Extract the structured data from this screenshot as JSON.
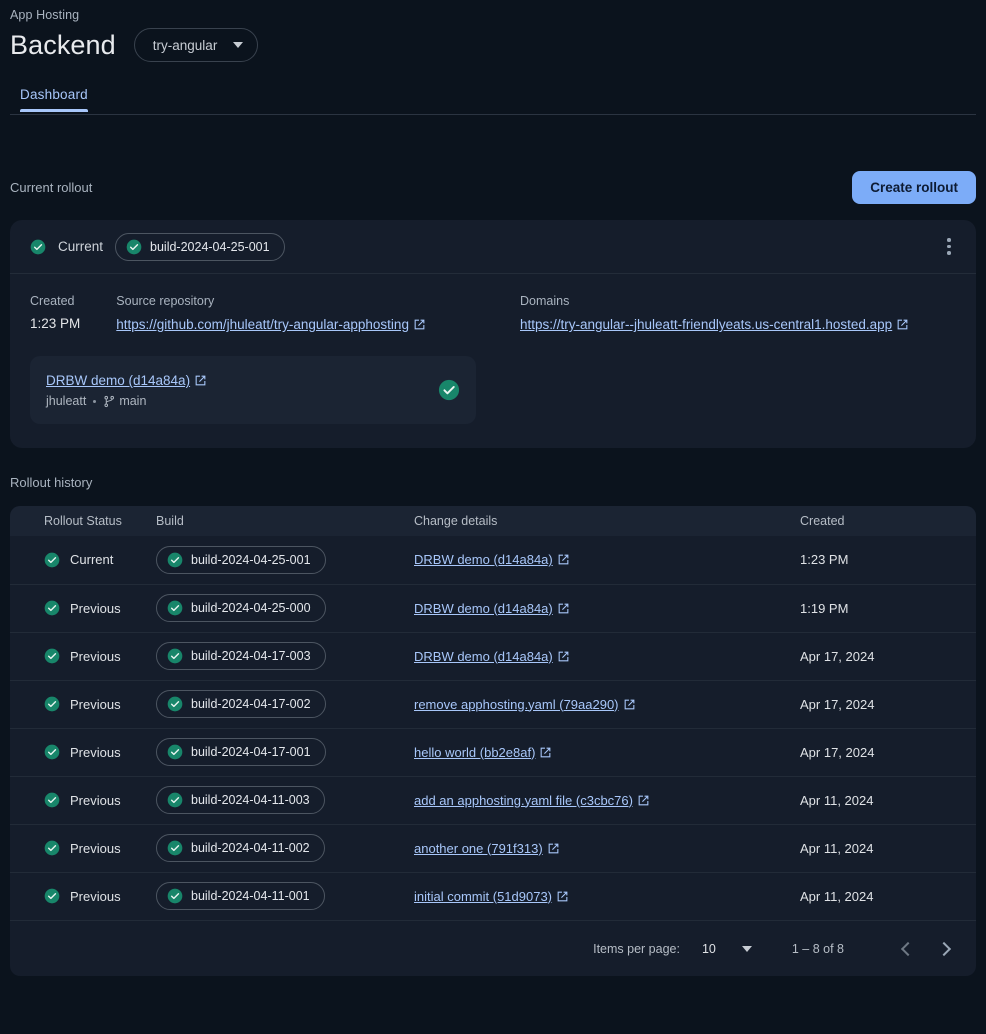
{
  "header": {
    "breadcrumb": "App Hosting",
    "title": "Backend",
    "project": "try-angular",
    "tabs": [
      {
        "label": "Dashboard"
      }
    ]
  },
  "current_rollout_section": {
    "label": "Current rollout",
    "create_button": "Create rollout"
  },
  "current_rollout": {
    "status": "Current",
    "build": "build-2024-04-25-001",
    "created_label": "Created",
    "created_value": "1:23 PM",
    "source_repo_label": "Source repository",
    "source_repo_url": "https://github.com/jhuleatt/try-angular-apphosting",
    "domains_label": "Domains",
    "domain_url": "https://try-angular--jhuleatt-friendlyeats.us-central1.hosted.app",
    "commit": {
      "title": "DRBW demo (d14a84a)",
      "author": "jhuleatt",
      "branch": "main"
    }
  },
  "history": {
    "label": "Rollout history",
    "columns": [
      "Rollout Status",
      "Build",
      "Change details",
      "Created"
    ],
    "rows": [
      {
        "status": "Current",
        "build": "build-2024-04-25-001",
        "change": "DRBW demo (d14a84a)",
        "created": "1:23 PM"
      },
      {
        "status": "Previous",
        "build": "build-2024-04-25-000",
        "change": "DRBW demo (d14a84a)",
        "created": "1:19 PM"
      },
      {
        "status": "Previous",
        "build": "build-2024-04-17-003",
        "change": "DRBW demo (d14a84a)",
        "created": "Apr 17, 2024"
      },
      {
        "status": "Previous",
        "build": "build-2024-04-17-002",
        "change": "remove apphosting.yaml (79aa290)",
        "created": "Apr 17, 2024"
      },
      {
        "status": "Previous",
        "build": "build-2024-04-17-001",
        "change": "hello world (bb2e8af)",
        "created": "Apr 17, 2024"
      },
      {
        "status": "Previous",
        "build": "build-2024-04-11-003",
        "change": "add an apphosting.yaml file (c3cbc76)",
        "created": "Apr 11, 2024"
      },
      {
        "status": "Previous",
        "build": "build-2024-04-11-002",
        "change": "another one (791f313)",
        "created": "Apr 11, 2024"
      },
      {
        "status": "Previous",
        "build": "build-2024-04-11-001",
        "change": "initial commit (51d9073)",
        "created": "Apr 11, 2024"
      }
    ]
  },
  "paginator": {
    "items_per_page_label": "Items per page:",
    "items_per_page_value": "10",
    "range": "1 – 8 of 8"
  },
  "colors": {
    "page_bg": "#0b131d",
    "card_bg": "#151d2b",
    "accent_blue": "#a8c7fa",
    "button_blue": "#7cacf8",
    "success_green": "#18866a"
  }
}
